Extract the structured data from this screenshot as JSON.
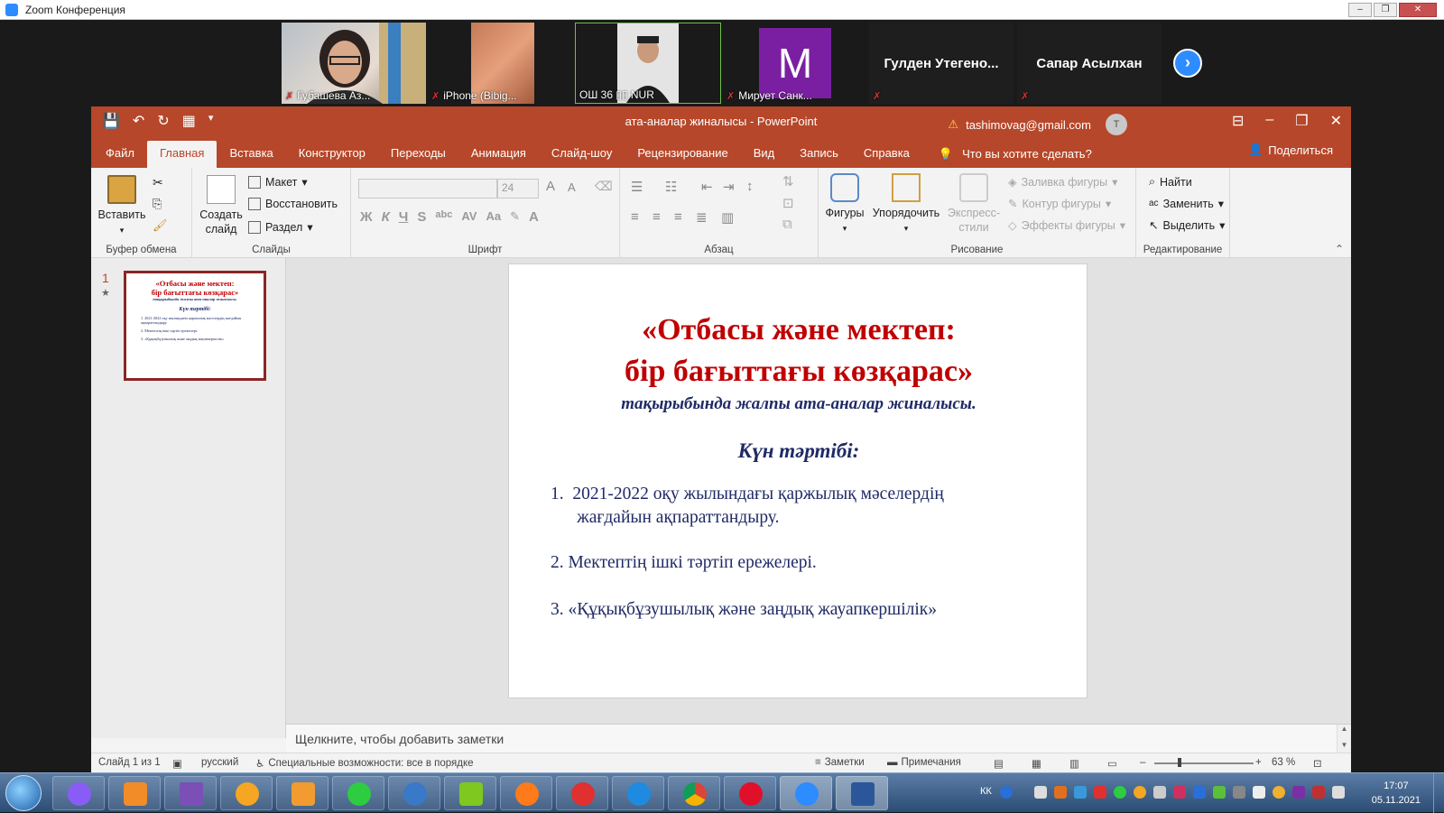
{
  "zoom": {
    "title": "Zoom Конференция",
    "participants": [
      {
        "name": "Губашева Аз...",
        "muted": true
      },
      {
        "name": "iPhone (Bibig...",
        "muted": true
      },
      {
        "name": "ОШ 36 ▯▯   NUR",
        "muted": false
      },
      {
        "name": "Мирует Санк...",
        "muted": true,
        "initial": "M"
      },
      {
        "name": "Гулден  Утегено...",
        "muted": true
      },
      {
        "name": "Сапар Асылхан",
        "muted": true
      }
    ],
    "colors": {
      "accent": "#2d8cff",
      "initial_bg": "#7b1fa2",
      "mic_off": "#e03030"
    }
  },
  "ppt": {
    "doc_title": "ата-аналар жиналысы  -  PowerPoint",
    "account": "tashimovag@gmail.com",
    "avatar": "T",
    "tabs": [
      "Файл",
      "Главная",
      "Вставка",
      "Конструктор",
      "Переходы",
      "Анимация",
      "Слайд-шоу",
      "Рецензирование",
      "Вид",
      "Запись",
      "Справка"
    ],
    "tell_me": "Что вы хотите сделать?",
    "share": "Поделиться",
    "ribbon": {
      "clipboard": {
        "paste": "Вставить",
        "label": "Буфер обмена"
      },
      "slides": {
        "new_slide": "Создать слайд",
        "layout": "Макет",
        "reset": "Восстановить",
        "section": "Раздел",
        "label": "Слайды"
      },
      "font": {
        "size": "24",
        "label": "Шрифт",
        "bold": "Ж",
        "italic": "К",
        "underline": "Ч",
        "strike": "S",
        "case": "Aa"
      },
      "paragraph": {
        "label": "Абзац"
      },
      "drawing": {
        "shapes": "Фигуры",
        "arrange": "Упорядочить",
        "quick_styles": "Экспресс-стили",
        "fill": "Заливка фигуры",
        "outline": "Контур фигуры",
        "effects": "Эффекты фигуры",
        "label": "Рисование"
      },
      "editing": {
        "find": "Найти",
        "replace": "Заменить",
        "select": "Выделить",
        "label": "Редактирование"
      }
    },
    "thumb": {
      "number": "1"
    },
    "slide": {
      "title_line1": "«Отбасы және мектеп:",
      "title_line2": "бір бағыттағы көзқарас»",
      "subtitle": "тақырыбында жалпы ата-аналар жиналысы.",
      "agenda": "Күн тәртібі:",
      "items": [
        "1.  2021-2022 оқу жылындағы қаржылық мәселердің\n      жағдайын ақпараттандыру.",
        "2. Мектептің ішкі тәртіп ережелері.",
        "3. «Құқықбұзушылық және заңдық жауапкершілік»"
      ]
    },
    "notes_placeholder": "Щелкните, чтобы добавить заметки",
    "status": {
      "slide": "Слайд 1 из 1",
      "language": "русский",
      "accessibility": "Специальные возможности: все в порядке",
      "notes": "Заметки",
      "comments": "Примечания",
      "zoom": "63 %"
    },
    "colors": {
      "brand": "#b7472a",
      "title_red": "#c00000",
      "navy": "#1f2a66"
    }
  },
  "taskbar": {
    "lang": "КК",
    "time": "17:07",
    "date": "05.11.2021"
  }
}
